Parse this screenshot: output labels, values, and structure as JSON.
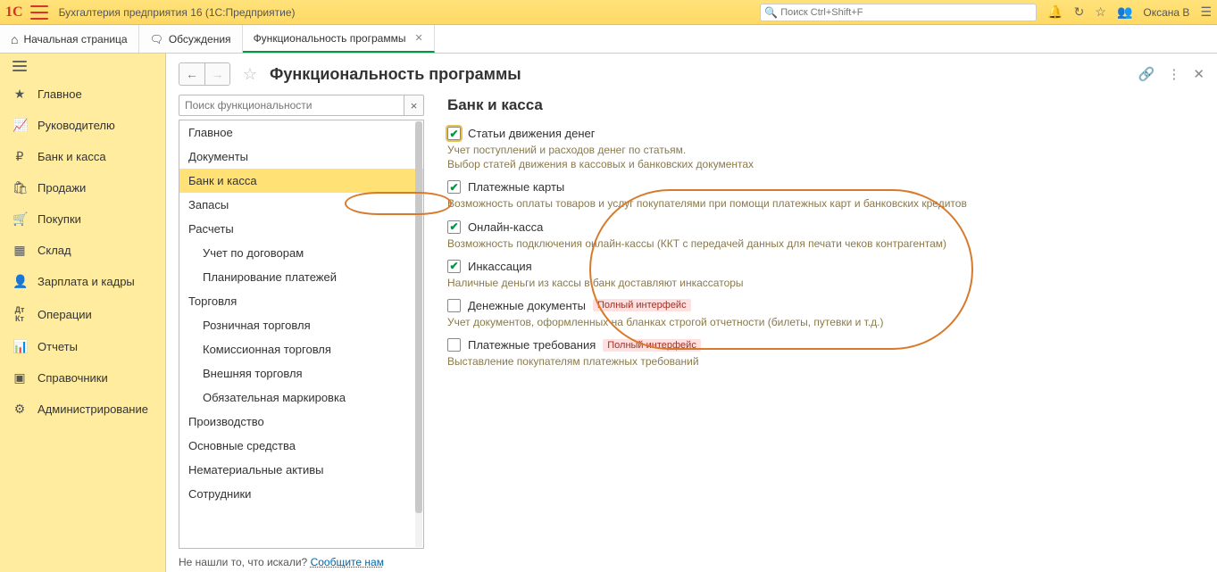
{
  "titlebar": {
    "logo_text": "1С",
    "app_title": "Бухгалтерия предприятия 16  (1С:Предприятие)",
    "search_placeholder": "Поиск Ctrl+Shift+F",
    "user": "Оксана В"
  },
  "tabs": {
    "home": "Начальная страница",
    "discuss": "Обсуждения",
    "func": "Функциональность программы"
  },
  "sidebar": {
    "items": [
      "Главное",
      "Руководителю",
      "Банк и касса",
      "Продажи",
      "Покупки",
      "Склад",
      "Зарплата и кадры",
      "Операции",
      "Отчеты",
      "Справочники",
      "Администрирование"
    ]
  },
  "page": {
    "title": "Функциональность программы",
    "tree_search_placeholder": "Поиск функциональности",
    "section_title": "Банк и касса",
    "not_found_prefix": "Не нашли то, что искали?  ",
    "not_found_link": "Сообщите нам"
  },
  "tree": [
    {
      "label": "Главное",
      "sub": false
    },
    {
      "label": "Документы",
      "sub": false
    },
    {
      "label": "Банк и касса",
      "sub": false,
      "active": true
    },
    {
      "label": "Запасы",
      "sub": false
    },
    {
      "label": "Расчеты",
      "sub": false
    },
    {
      "label": "Учет по договорам",
      "sub": true
    },
    {
      "label": "Планирование платежей",
      "sub": true
    },
    {
      "label": "Торговля",
      "sub": false
    },
    {
      "label": "Розничная торговля",
      "sub": true
    },
    {
      "label": "Комиссионная торговля",
      "sub": true
    },
    {
      "label": "Внешняя торговля",
      "sub": true
    },
    {
      "label": "Обязательная маркировка",
      "sub": true
    },
    {
      "label": "Производство",
      "sub": false
    },
    {
      "label": "Основные средства",
      "sub": false
    },
    {
      "label": "Нематериальные активы",
      "sub": false
    },
    {
      "label": "Сотрудники",
      "sub": false
    }
  ],
  "settings": [
    {
      "label": "Статьи движения денег",
      "checked": true,
      "hl": true,
      "desc": "Учет поступлений и расходов денег по статьям.\nВыбор статей движения в кассовых и банковских документах"
    },
    {
      "label": "Платежные карты",
      "checked": true,
      "desc": "Возможность оплаты товаров и услуг покупателями при помощи платежных карт и банковских кредитов"
    },
    {
      "label": "Онлайн-касса",
      "checked": true,
      "desc": "Возможность подключения онлайн-кассы (ККТ с передачей данных для печати чеков контрагентам)"
    },
    {
      "label": "Инкассация",
      "checked": true,
      "desc": "Наличные деньги из кассы в банк доставляют инкассаторы"
    },
    {
      "label": "Денежные документы",
      "checked": false,
      "badge": "Полный интерфейс",
      "desc": "Учет документов, оформленных на бланках строгой отчетности (билеты, путевки и т.д.)"
    },
    {
      "label": "Платежные требования",
      "checked": false,
      "badge": "Полный интерфейс",
      "desc": "Выставление покупателям платежных требований"
    }
  ]
}
